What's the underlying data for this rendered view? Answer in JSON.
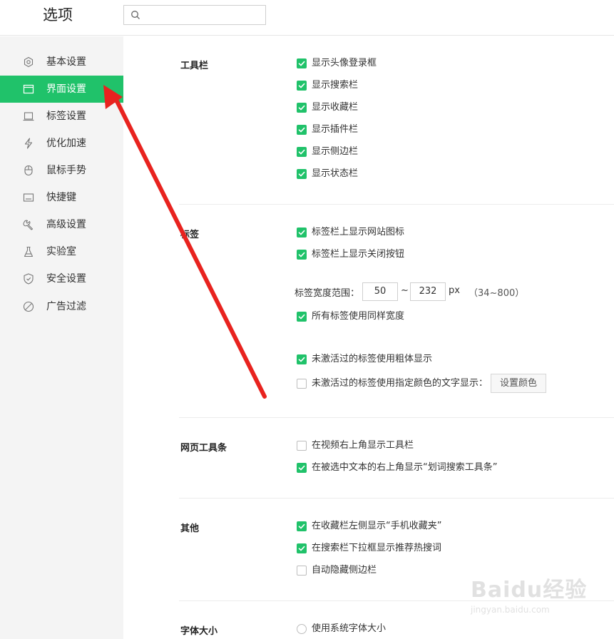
{
  "window": {
    "title": "选项"
  },
  "search": {
    "placeholder": ""
  },
  "sidebar": {
    "items": [
      {
        "label": "基本设置",
        "icon": "gear-icon",
        "active": false
      },
      {
        "label": "界面设置",
        "icon": "window-icon",
        "active": true
      },
      {
        "label": "标签设置",
        "icon": "tab-icon",
        "active": false
      },
      {
        "label": "优化加速",
        "icon": "lightning-icon",
        "active": false
      },
      {
        "label": "鼠标手势",
        "icon": "mouse-icon",
        "active": false
      },
      {
        "label": "快捷键",
        "icon": "keyboard-icon",
        "active": false
      },
      {
        "label": "高级设置",
        "icon": "wrench-icon",
        "active": false
      },
      {
        "label": "实验室",
        "icon": "flask-icon",
        "active": false
      },
      {
        "label": "安全设置",
        "icon": "shield-icon",
        "active": false
      },
      {
        "label": "广告过滤",
        "icon": "block-icon",
        "active": false
      }
    ]
  },
  "sections": {
    "toolbar": {
      "title": "工具栏",
      "options": [
        {
          "label": "显示头像登录框",
          "checked": true
        },
        {
          "label": "显示搜索栏",
          "checked": true
        },
        {
          "label": "显示收藏栏",
          "checked": true
        },
        {
          "label": "显示插件栏",
          "checked": true
        },
        {
          "label": "显示侧边栏",
          "checked": true
        },
        {
          "label": "显示状态栏",
          "checked": true
        }
      ]
    },
    "tabs": {
      "title": "标签",
      "options": [
        {
          "label": "标签栏上显示网站图标",
          "checked": true
        },
        {
          "label": "标签栏上显示关闭按钮",
          "checked": true
        },
        {
          "label": "所有标签使用同样宽度",
          "checked": true
        },
        {
          "label": "未激活过的标签使用粗体显示",
          "checked": true
        },
        {
          "label": "未激活过的标签使用指定颜色的文字显示：",
          "checked": false
        }
      ],
      "width_label": "标签宽度范围：",
      "width_min": "50",
      "width_sep": "~",
      "width_max": "232",
      "width_unit": "px",
      "width_range": "（34~800）",
      "color_button": "设置颜色"
    },
    "webbar": {
      "title": "网页工具条",
      "options": [
        {
          "label": "在视频右上角显示工具栏",
          "checked": false
        },
        {
          "label": "在被选中文本的右上角显示“划词搜索工具条”",
          "checked": true
        }
      ]
    },
    "other": {
      "title": "其他",
      "options": [
        {
          "label": "在收藏栏左侧显示“手机收藏夹”",
          "checked": true
        },
        {
          "label": "在搜索栏下拉框显示推荐热搜词",
          "checked": true
        },
        {
          "label": "自动隐藏侧边栏",
          "checked": false
        }
      ]
    },
    "font": {
      "title": "字体大小",
      "options": [
        {
          "label": "使用系统字体大小",
          "checked": false
        }
      ]
    }
  },
  "colors": {
    "accent": "#20c26a",
    "annotation_arrow": "#e8231f"
  },
  "watermark": {
    "brand": "Baidu经验",
    "url": "jingyan.baidu.com"
  }
}
